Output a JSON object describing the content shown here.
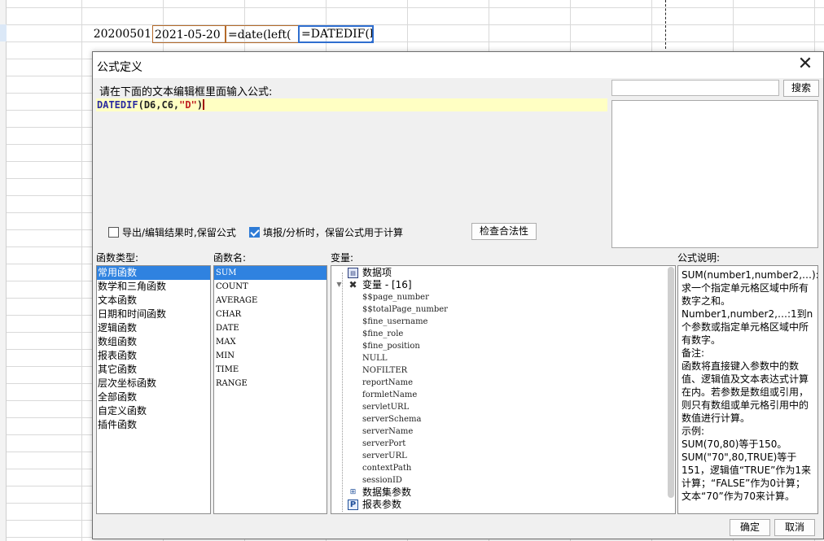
{
  "sheet": {
    "cell_a": "20200501",
    "cell_b": "2021-05-20",
    "cell_c": "=date(left(",
    "cell_d": "=DATEDIF(D"
  },
  "dialog": {
    "title": "公式定义",
    "close_symbol": "✕",
    "prompt": "请在下面的文本编辑框里面输入公式:",
    "formula": {
      "fn": "DATEDIF",
      "open": "(",
      "args": "D6,C6,",
      "str": "\"D\"",
      "close": ")"
    },
    "search": {
      "value": "",
      "button": "搜索"
    },
    "options": {
      "export_label": "导出/编辑结果时,保留公式",
      "export_checked": false,
      "fill_label": "填报/分析时，保留公式用于计算",
      "fill_checked": true,
      "validate_button": "检查合法性"
    },
    "labels": {
      "func_type": "函数类型:",
      "func_name": "函数名:",
      "variables": "变量:",
      "description": "公式说明:"
    },
    "func_types": [
      "常用函数",
      "数学和三角函数",
      "文本函数",
      "日期和时间函数",
      "逻辑函数",
      "数组函数",
      "报表函数",
      "其它函数",
      "层次坐标函数",
      "全部函数",
      "自定义函数",
      "插件函数"
    ],
    "func_names": [
      "SUM",
      "COUNT",
      "AVERAGE",
      "CHAR",
      "DATE",
      "MAX",
      "MIN",
      "TIME",
      "RANGE"
    ],
    "variables": {
      "data_item": "数据项",
      "var_group": "变量 - [16]",
      "var_items": [
        "$$page_number",
        "$$totalPage_number",
        "$fine_username",
        "$fine_role",
        "$fine_position",
        "NULL",
        "NOFILTER",
        "reportName",
        "formletName",
        "servletURL",
        "serverSchema",
        "serverName",
        "serverPort",
        "serverURL",
        "contextPath",
        "sessionID"
      ],
      "dataset_params": "数据集参数",
      "report_params": "报表参数"
    },
    "description_lines": [
      "SUM(number1,number2,…):求一个指定单元格区域中所有数字之和。",
      "Number1,number2,…:1到n个参数或指定单元格区域中所有数字。",
      "备注:",
      "函数将直接键入参数中的数值、逻辑值及文本表达式计算在内。若参数是数组或引用，则只有数组或单元格引用中的数值进行计算。",
      "示例:",
      "SUM(70,80)等于150。",
      "SUM(\"70\",80,TRUE)等于151，逻辑值“TRUE”作为1来计算；“FALSE”作为0计算；文本“70”作为70来计算。"
    ],
    "ok": "确定",
    "cancel": "取消"
  }
}
